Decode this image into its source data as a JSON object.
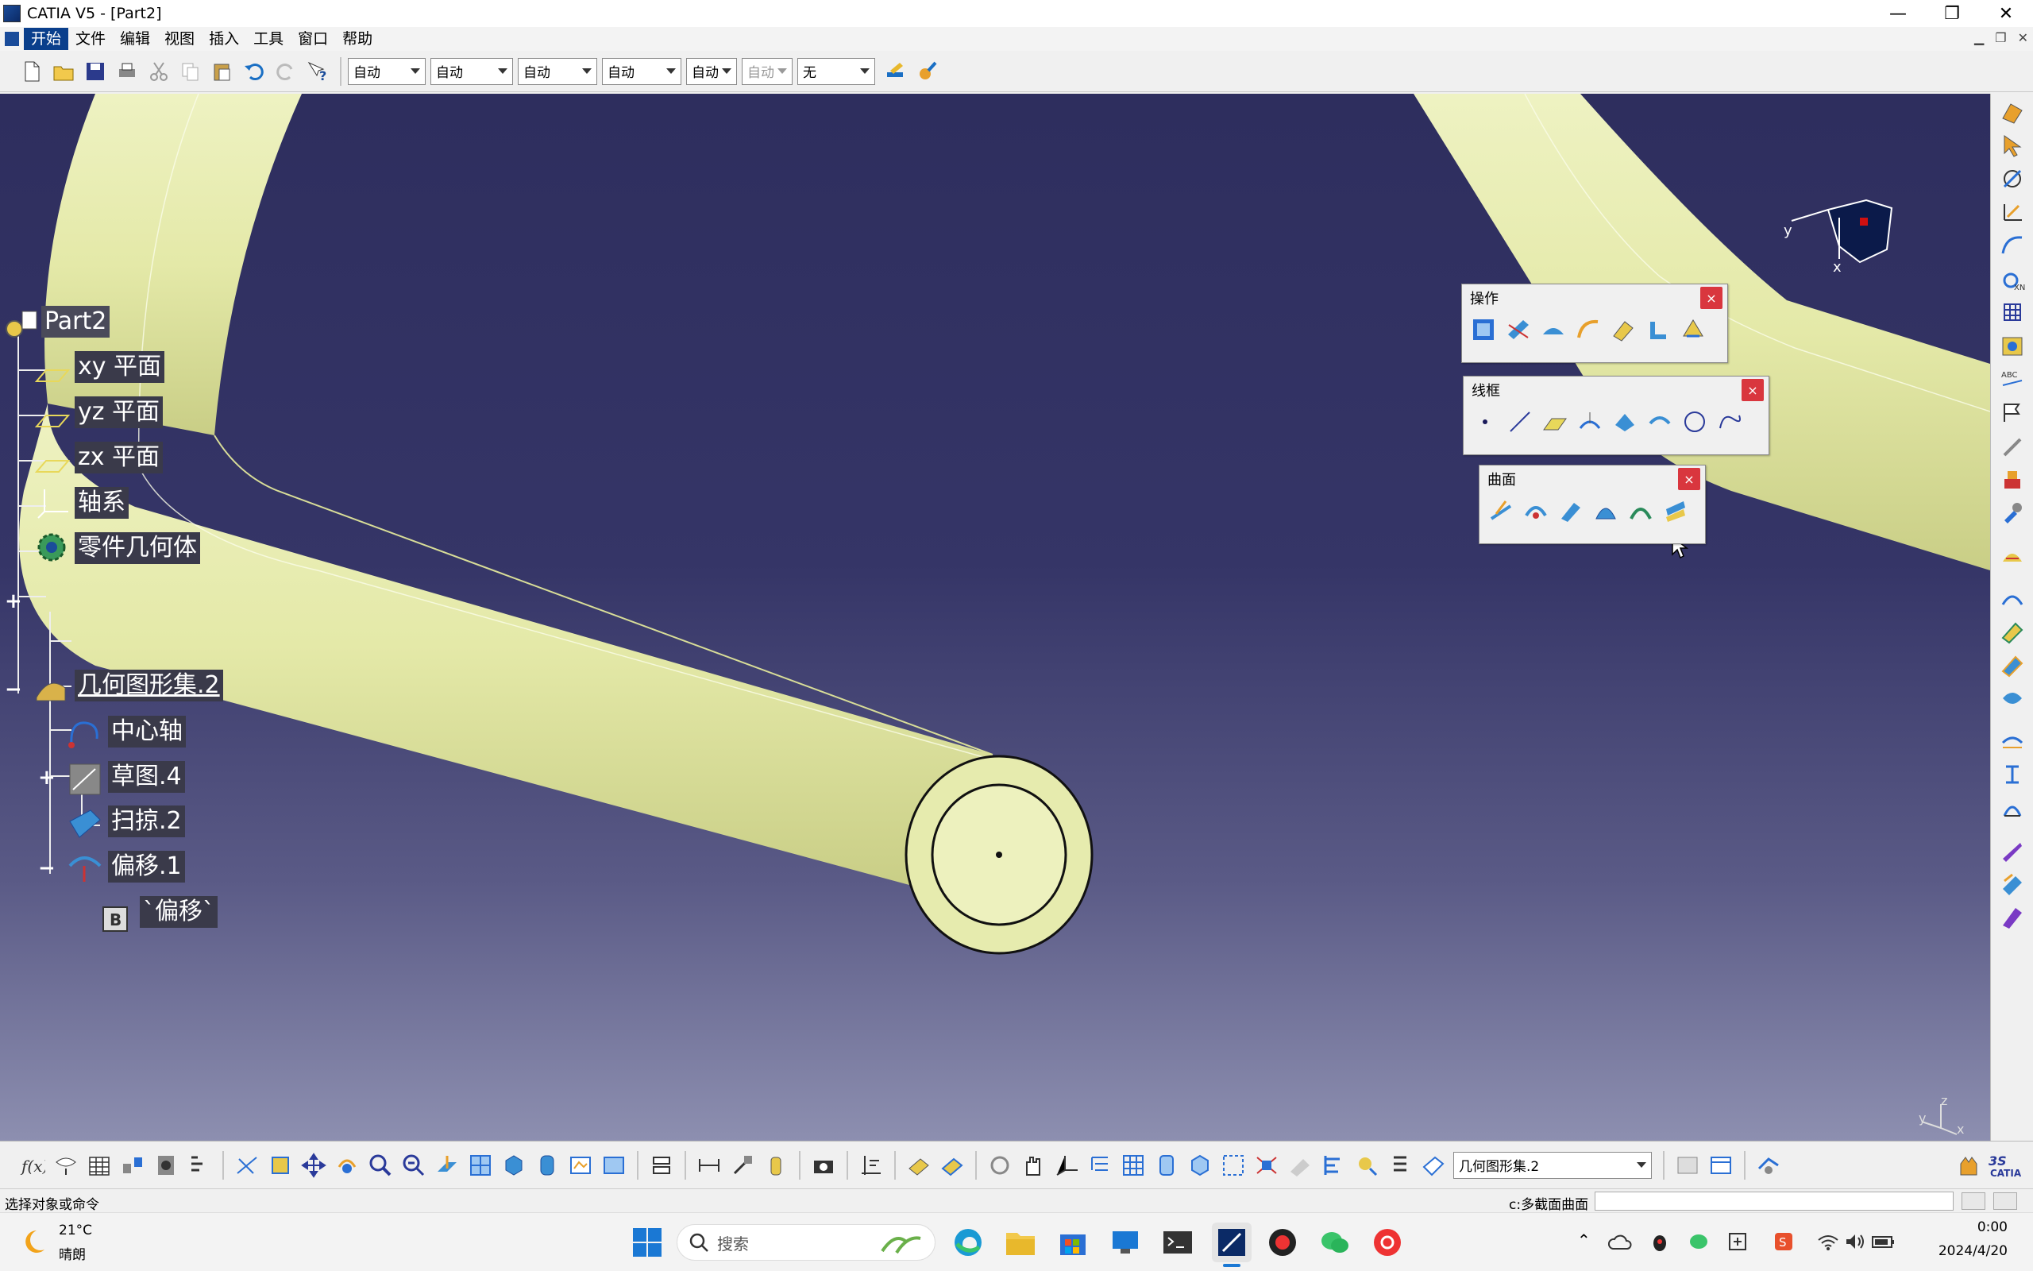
{
  "window": {
    "title": "CATIA V5 - [Part2]",
    "minimize": "—",
    "maximize": "❐",
    "close": "✕"
  },
  "menu": {
    "items": [
      "开始",
      "文件",
      "编辑",
      "视图",
      "插入",
      "工具",
      "窗口",
      "帮助"
    ]
  },
  "toolbar": {
    "combos": [
      "自动",
      "自动",
      "自动",
      "自动",
      "自动",
      "自动",
      "无"
    ]
  },
  "tree": {
    "root": "Part2",
    "nodes": [
      "xy 平面",
      "yz 平面",
      "zx 平面",
      "轴系",
      "零件几何体",
      "几何图形集.2",
      "中心轴",
      "草图.4",
      "扫掠.2",
      "偏移.1",
      "`偏移`"
    ]
  },
  "panels": {
    "operation": {
      "title": "操作",
      "close": "×"
    },
    "wireframe": {
      "title": "线框",
      "close": "×"
    },
    "surface": {
      "title": "曲面",
      "close": "×"
    }
  },
  "compass": {
    "y": "y",
    "x": "x",
    "z": "z"
  },
  "bottom": {
    "combo_value": "几何图形集.2"
  },
  "status": {
    "left": "选择对象或命令",
    "right": "c:多截面曲面"
  },
  "taskbar": {
    "weather_temp": "21°C",
    "weather_desc": "晴朗",
    "search_placeholder": "搜索",
    "time": "0:00",
    "date": "2024/4/20"
  },
  "colors": {
    "pipe": "#e9eeb0",
    "viewport_top": "#2e2e5e",
    "accent": "#0a3f8c"
  }
}
